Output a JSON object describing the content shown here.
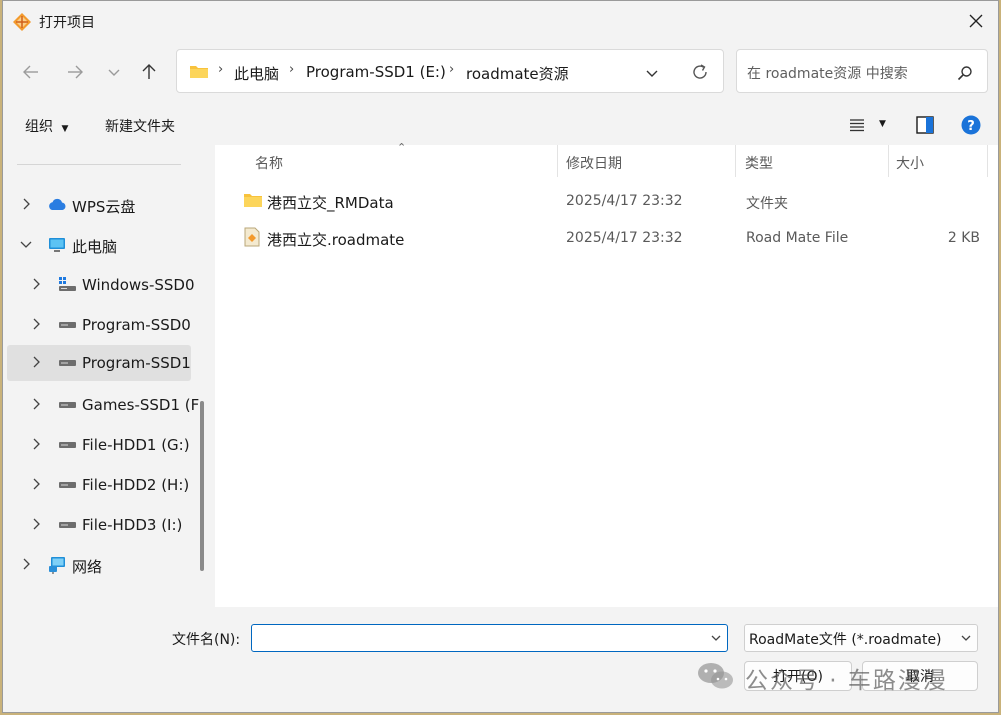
{
  "window": {
    "title": "打开项目"
  },
  "address": {
    "crumbs": [
      "此电脑",
      "Program-SSD1 (E:)",
      "roadmate资源"
    ]
  },
  "search": {
    "placeholder": "在 roadmate资源 中搜索"
  },
  "toolbar": {
    "organize": "组织",
    "new_folder": "新建文件夹"
  },
  "sidebar": {
    "items": [
      {
        "label": "WPS云盘",
        "icon": "cloud-icon"
      },
      {
        "label": "此电脑",
        "icon": "computer-icon"
      },
      {
        "label": "Windows-SSD0",
        "icon": "windows-drive-icon"
      },
      {
        "label": "Program-SSD0",
        "icon": "drive-icon"
      },
      {
        "label": "Program-SSD1",
        "icon": "drive-icon"
      },
      {
        "label": "Games-SSD1 (F",
        "icon": "drive-icon"
      },
      {
        "label": "File-HDD1 (G:)",
        "icon": "drive-icon"
      },
      {
        "label": "File-HDD2 (H:)",
        "icon": "drive-icon"
      },
      {
        "label": "File-HDD3 (I:)",
        "icon": "drive-icon"
      },
      {
        "label": "网络",
        "icon": "network-icon"
      }
    ]
  },
  "files": {
    "columns": {
      "name": "名称",
      "date": "修改日期",
      "type": "类型",
      "size": "大小"
    },
    "rows": [
      {
        "name": "港西立交_RMData",
        "date": "2025/4/17 23:32",
        "type": "文件夹",
        "size": "",
        "icon": "folder-icon"
      },
      {
        "name": "港西立交.roadmate",
        "date": "2025/4/17 23:32",
        "type": "Road Mate File",
        "size": "2 KB",
        "icon": "roadmate-file-icon"
      }
    ]
  },
  "footer": {
    "filename_label": "文件名(N):",
    "filename_value": "",
    "filter_value": "RoadMate文件 (*.roadmate)",
    "open_label": "打开(O)",
    "cancel_label": "取消"
  },
  "watermark": {
    "text": "公众号 · 车路漫漫"
  },
  "colors": {
    "accent": "#0067c0",
    "folder": "#f8c23c",
    "help": "#1a73d9"
  }
}
